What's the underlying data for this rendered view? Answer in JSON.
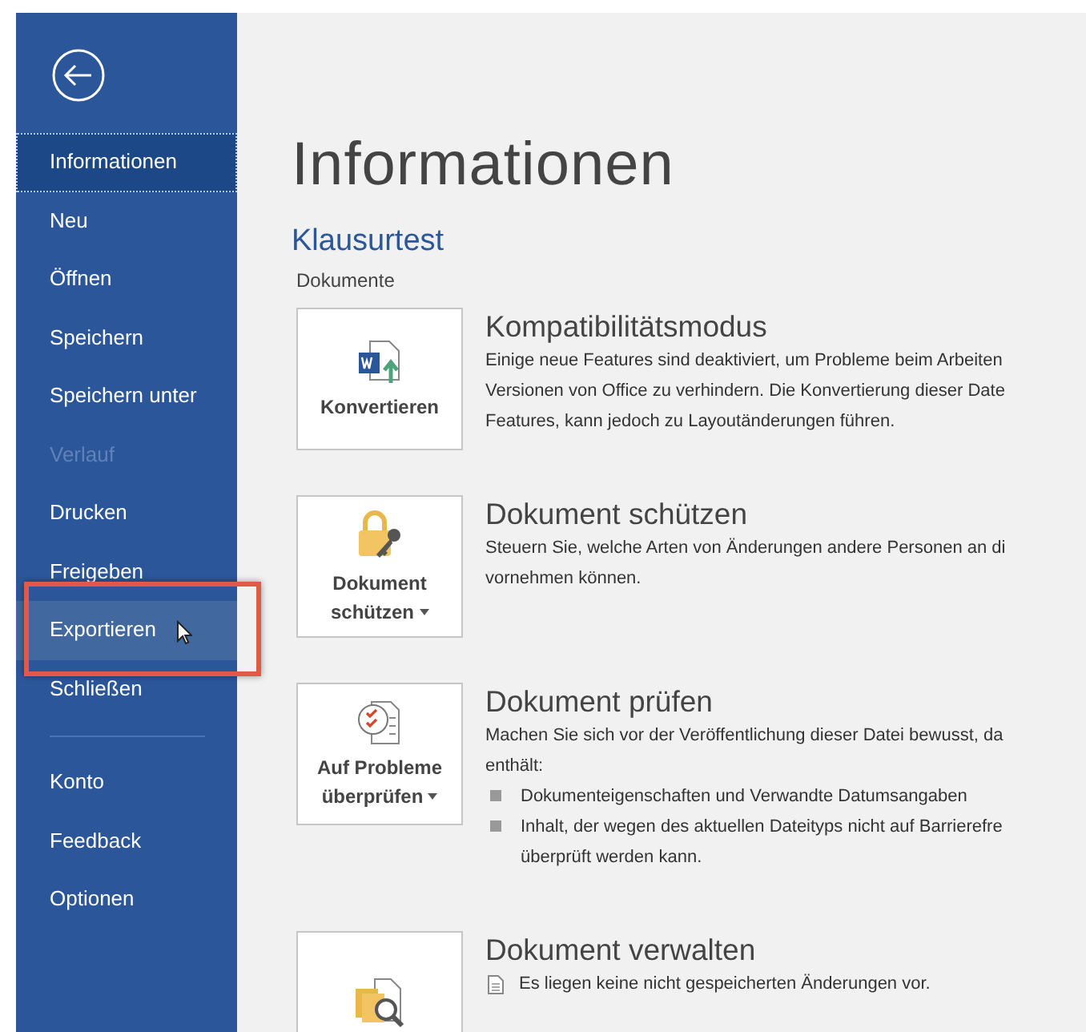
{
  "sidebar": {
    "items": [
      {
        "label": "Informationen",
        "selected": true,
        "disabled": false,
        "hovered": false
      },
      {
        "label": "Neu",
        "selected": false,
        "disabled": false,
        "hovered": false
      },
      {
        "label": "Öffnen",
        "selected": false,
        "disabled": false,
        "hovered": false
      },
      {
        "label": "Speichern",
        "selected": false,
        "disabled": false,
        "hovered": false
      },
      {
        "label": "Speichern unter",
        "selected": false,
        "disabled": false,
        "hovered": false
      },
      {
        "label": "Verlauf",
        "selected": false,
        "disabled": true,
        "hovered": false
      },
      {
        "label": "Drucken",
        "selected": false,
        "disabled": false,
        "hovered": false
      },
      {
        "label": "Freigeben",
        "selected": false,
        "disabled": false,
        "hovered": false
      },
      {
        "label": "Exportieren",
        "selected": false,
        "disabled": false,
        "hovered": true
      },
      {
        "label": "Schließen",
        "selected": false,
        "disabled": false,
        "hovered": false
      }
    ],
    "footer_items": [
      {
        "label": "Konto",
        "selected": false
      },
      {
        "label": "Feedback",
        "selected": false
      },
      {
        "label": "Optionen",
        "selected": false
      }
    ]
  },
  "page_title": "Informationen",
  "document_name": "Klausurtest",
  "location": "Dokumente",
  "sections": [
    {
      "button_lines": [
        "Konvertieren"
      ],
      "dropdown": false,
      "title": "Kompatibilitätsmodus",
      "lines": [
        "Einige neue Features sind deaktiviert, um Probleme beim Arbeiten",
        "Versionen von Office zu verhindern. Die Konvertierung dieser Date",
        "Features, kann jedoch zu Layoutänderungen führen."
      ]
    },
    {
      "button_lines": [
        "Dokument",
        "schützen"
      ],
      "dropdown": true,
      "title": "Dokument schützen",
      "lines": [
        "Steuern Sie, welche Arten von Änderungen andere Personen an di",
        "vornehmen können."
      ]
    },
    {
      "button_lines": [
        "Auf Probleme",
        "überprüfen"
      ],
      "dropdown": true,
      "title": "Dokument prüfen",
      "lines": [
        "Machen Sie sich vor der Veröffentlichung dieser Datei bewusst, da",
        "enthält:"
      ],
      "bullets": [
        {
          "kind": "square",
          "lines": [
            "Dokumenteigenschaften und Verwandte Datumsangaben"
          ]
        },
        {
          "kind": "square",
          "lines": [
            "Inhalt, der wegen des aktuellen Dateityps nicht auf Barrierefre",
            "überprüft werden kann."
          ]
        }
      ]
    },
    {
      "title": "Dokument verwalten",
      "bullets": [
        {
          "kind": "doc",
          "lines": [
            "Es liegen keine nicht gespeicherten Änderungen vor."
          ]
        }
      ]
    }
  ]
}
